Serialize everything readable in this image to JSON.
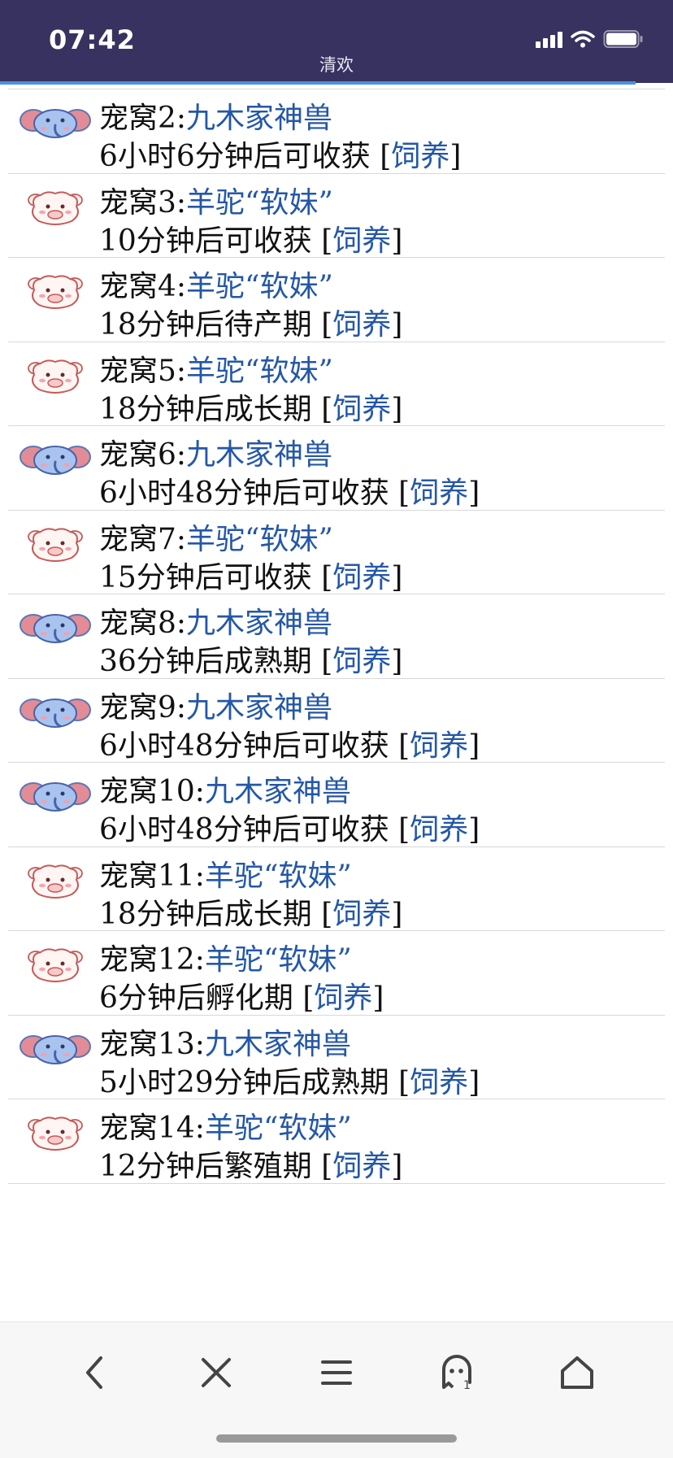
{
  "status_bar": {
    "time": "07:42",
    "title": "清欢",
    "icons": [
      "signal-icon",
      "wifi-icon",
      "battery-icon"
    ]
  },
  "load_progress": 0.945,
  "colors": {
    "header_bg": "#37325f",
    "link": "#2457a8",
    "progress": "#4a90e2"
  },
  "pets": [
    {
      "kennel": "宠窝2:",
      "name": "九木家神兽",
      "status": "6小时6分钟后可收获 [",
      "action": "饲养",
      "close": "]",
      "icon": "elephant-icon"
    },
    {
      "kennel": "宠窝3:",
      "name": "羊驼“软妹”",
      "status": "10分钟后可收获 [",
      "action": "饲养",
      "close": "]",
      "icon": "alpaca-icon"
    },
    {
      "kennel": "宠窝4:",
      "name": "羊驼“软妹”",
      "status": "18分钟后待产期 [",
      "action": "饲养",
      "close": "]",
      "icon": "alpaca-icon"
    },
    {
      "kennel": "宠窝5:",
      "name": "羊驼“软妹”",
      "status": "18分钟后成长期 [",
      "action": "饲养",
      "close": "]",
      "icon": "alpaca-icon"
    },
    {
      "kennel": "宠窝6:",
      "name": "九木家神兽",
      "status": "6小时48分钟后可收获 [",
      "action": "饲养",
      "close": "]",
      "icon": "elephant-icon"
    },
    {
      "kennel": "宠窝7:",
      "name": "羊驼“软妹”",
      "status": "15分钟后可收获 [",
      "action": "饲养",
      "close": "]",
      "icon": "alpaca-icon"
    },
    {
      "kennel": "宠窝8:",
      "name": "九木家神兽",
      "status": "36分钟后成熟期 [",
      "action": "饲养",
      "close": "]",
      "icon": "elephant-icon"
    },
    {
      "kennel": "宠窝9:",
      "name": "九木家神兽",
      "status": "6小时48分钟后可收获 [",
      "action": "饲养",
      "close": "]",
      "icon": "elephant-icon"
    },
    {
      "kennel": "宠窝10:",
      "name": "九木家神兽",
      "status": "6小时48分钟后可收获 [",
      "action": "饲养",
      "close": "]",
      "icon": "elephant-icon"
    },
    {
      "kennel": "宠窝11:",
      "name": "羊驼“软妹”",
      "status": "18分钟后成长期 [",
      "action": "饲养",
      "close": "]",
      "icon": "alpaca-icon"
    },
    {
      "kennel": "宠窝12:",
      "name": "羊驼“软妹”",
      "status": "6分钟后孵化期 [",
      "action": "饲养",
      "close": "]",
      "icon": "alpaca-icon"
    },
    {
      "kennel": "宠窝13:",
      "name": "九木家神兽",
      "status": "5小时29分钟后成熟期 [",
      "action": "饲养",
      "close": "]",
      "icon": "elephant-icon"
    },
    {
      "kennel": "宠窝14:",
      "name": "羊驼“软妹”",
      "status": "12分钟后繁殖期 [",
      "action": "饲养",
      "close": "]",
      "icon": "alpaca-icon"
    }
  ],
  "bottom_nav": [
    "back-icon",
    "close-icon",
    "menu-icon",
    "ghost-icon",
    "home-icon"
  ]
}
